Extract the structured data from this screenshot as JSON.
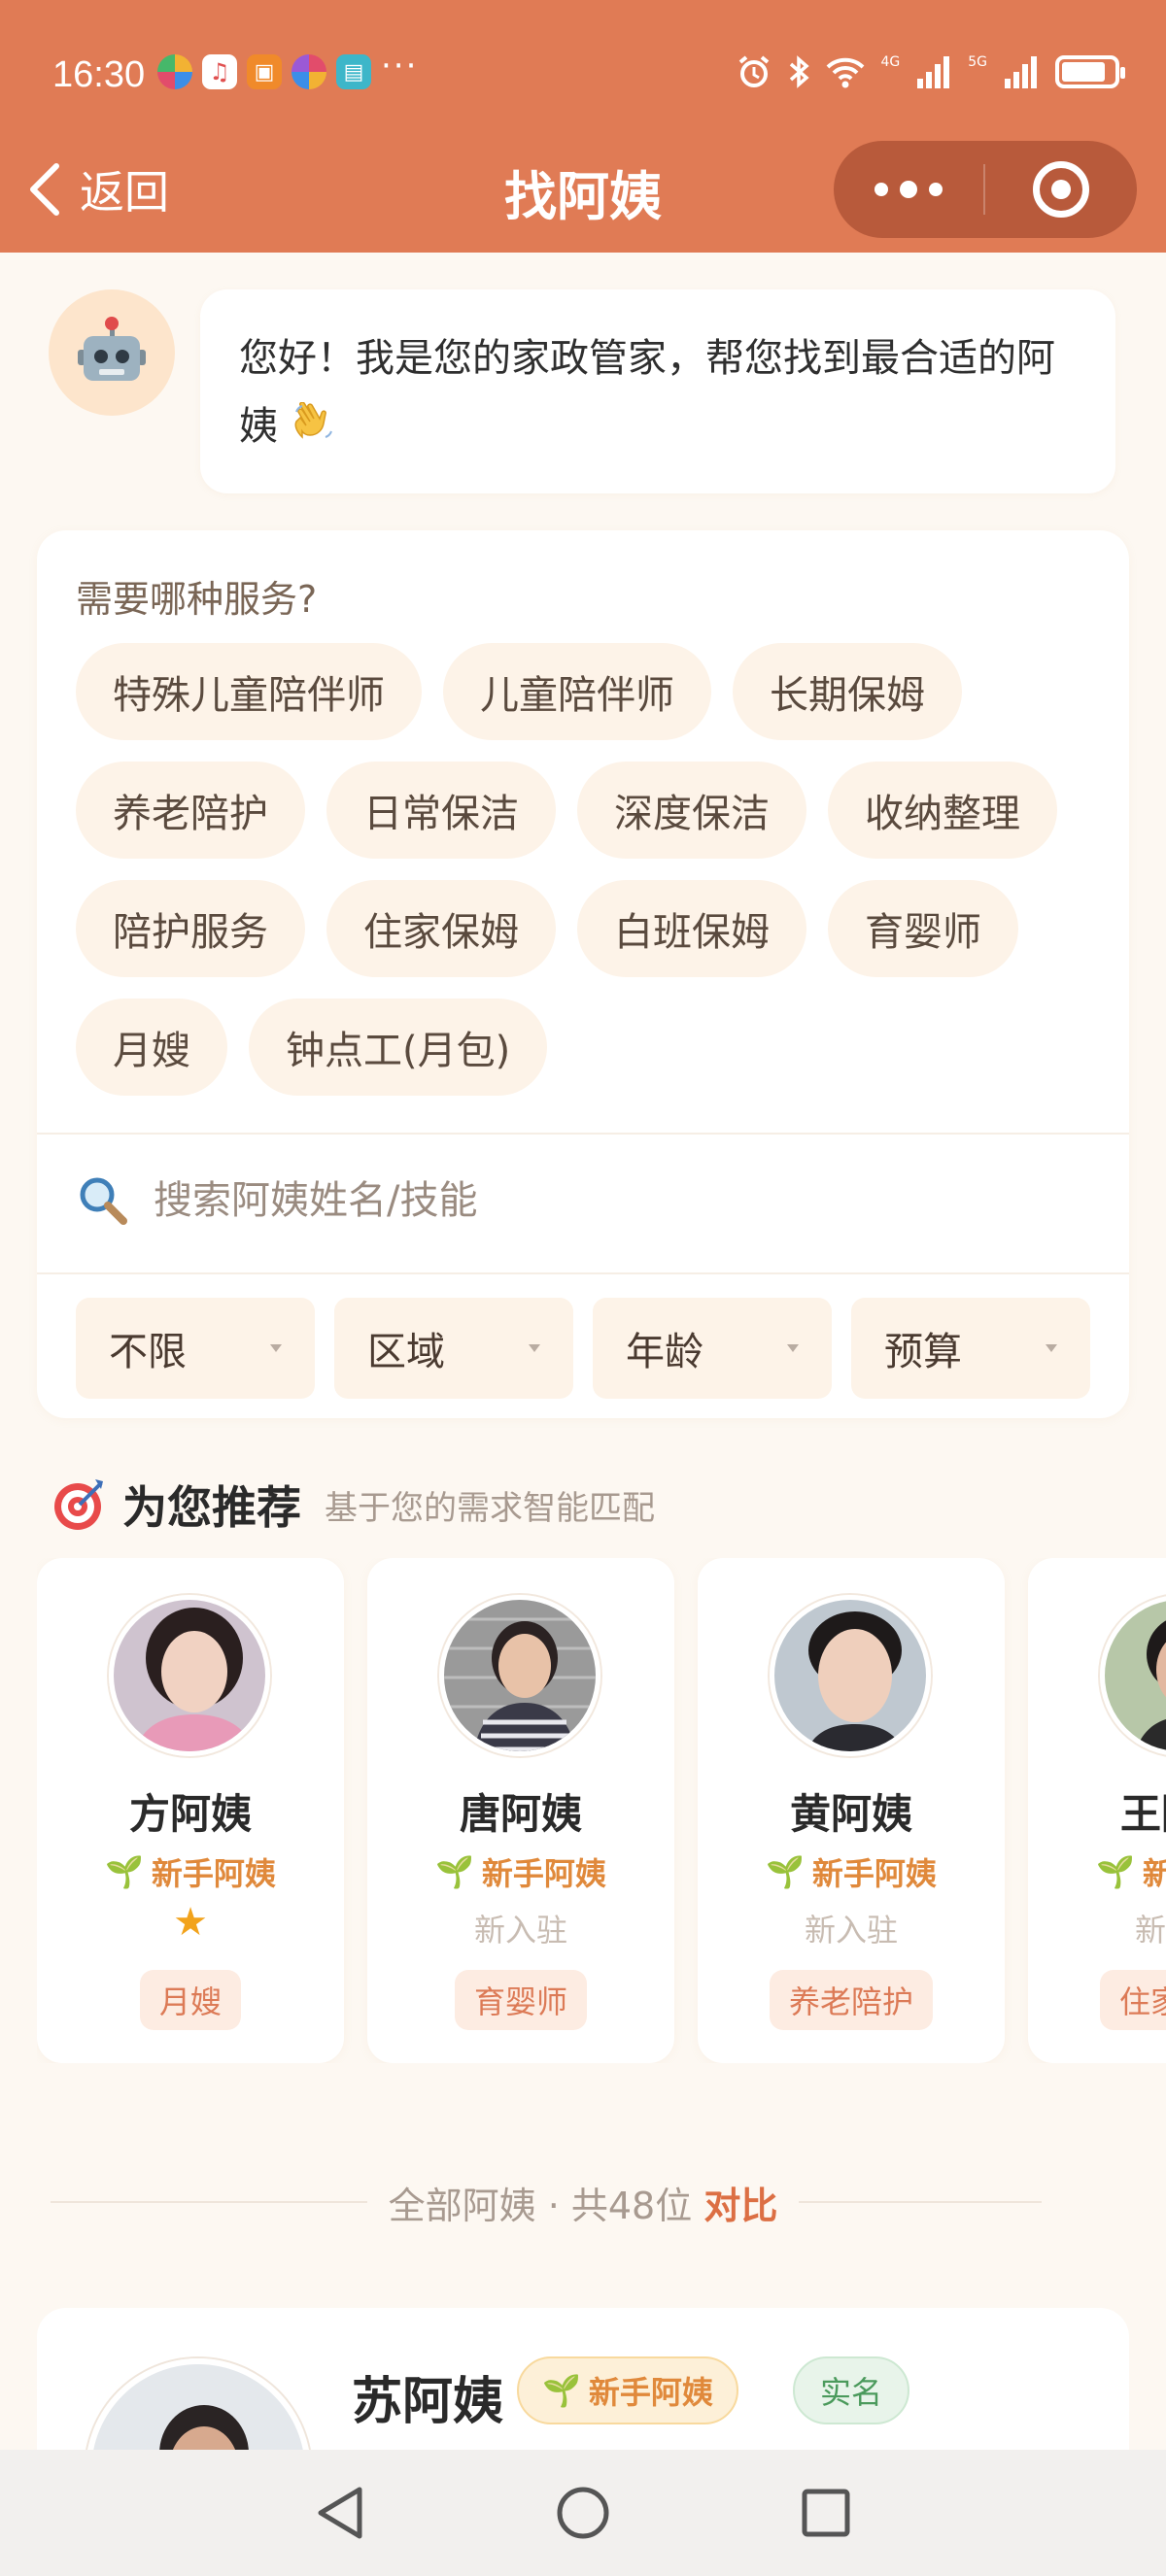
{
  "status_bar": {
    "time": "16:30",
    "more": "···",
    "net1": "4G",
    "net2": "5G"
  },
  "nav": {
    "back_label": "返回",
    "title": "找阿姨"
  },
  "greeting": {
    "text": "您好！我是您的家政管家，帮您找到最合适的阿姨"
  },
  "filter": {
    "question": "需要哪种服务?",
    "chips": [
      [
        "特殊儿童陪伴师",
        "儿童陪伴师",
        "长期保姆"
      ],
      [
        "养老陪护",
        "日常保洁",
        "深度保洁",
        "收纳整理"
      ],
      [
        "陪护服务",
        "住家保姆",
        "白班保姆",
        "育婴师"
      ],
      [
        "月嫂",
        "钟点工(月包)"
      ]
    ],
    "search_placeholder": "搜索阿姨姓名/技能",
    "selects": [
      "不限",
      "区域",
      "年龄",
      "预算"
    ]
  },
  "recommend": {
    "title": "为您推荐",
    "subtitle": "基于您的需求智能匹配",
    "cards": [
      {
        "name": "方阿姨",
        "badge": "新手阿姨",
        "status": "",
        "rating": "★",
        "tag": "月嫂"
      },
      {
        "name": "唐阿姨",
        "badge": "新手阿姨",
        "status": "新入驻",
        "rating": "",
        "tag": "育婴师"
      },
      {
        "name": "黄阿姨",
        "badge": "新手阿姨",
        "status": "新入驻",
        "rating": "",
        "tag": "养老陪护"
      },
      {
        "name": "王阿姨",
        "badge": "新手阿姨",
        "status": "新入驻",
        "rating": "",
        "tag": "住家保姆"
      }
    ]
  },
  "all": {
    "label": "全部阿姨 · 共48位",
    "compare": "对比"
  },
  "list": [
    {
      "name": "苏阿姨",
      "badge": "新手阿姨",
      "verified": "实名"
    }
  ],
  "colors": {
    "header": "#e07b55",
    "capsule": "#b85a3b",
    "accent": "#dc6f44",
    "badge": "#e0893b",
    "page_bg": "#fdf8f2"
  }
}
